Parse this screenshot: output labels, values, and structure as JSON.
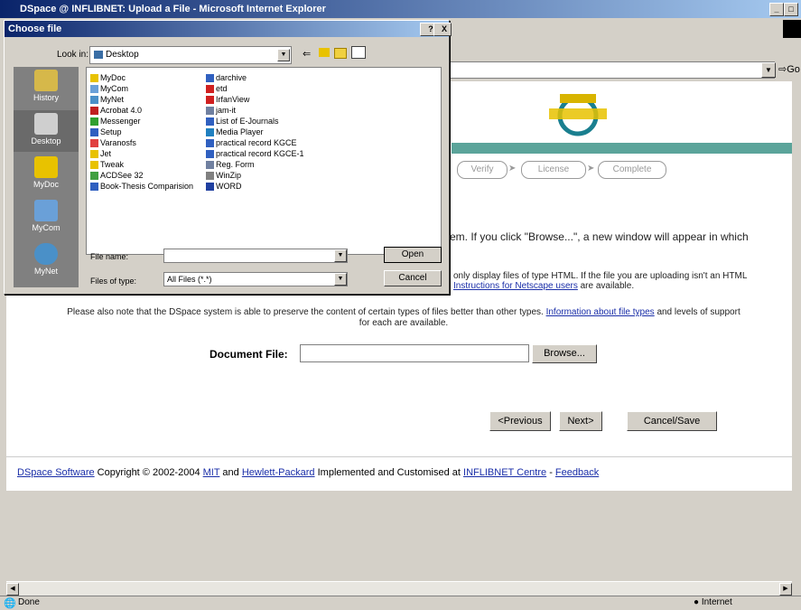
{
  "browser": {
    "title": "DSpace @ INFLIBNET: Upload a File - Microsoft Internet Explorer",
    "go_label": "Go",
    "status": "Done",
    "zone": "Internet"
  },
  "page": {
    "steps": [
      "Verify",
      "License",
      "Complete"
    ],
    "intro_partial": "em. If you click \"Browse...\", a new window will appear in which",
    "note_partial_1": "only display files of type HTML. If the file you are uploading isn't an HTML",
    "note_partial_2_link": "Instructions for Netscape users",
    "note_partial_2_rest": " are available.",
    "preserve_text_1": "Please also note that the DSpace system is able to preserve the content of certain types of files better than other types.",
    "preserve_link": "Information about file types",
    "preserve_text_2": "and levels of support",
    "preserve_text_3": "for each are available.",
    "document_file_label": "Document File:",
    "browse_label": "Browse...",
    "prev_label": "<Previous",
    "next_label": "Next>",
    "cancel_save_label": "Cancel/Save",
    "footer": {
      "dspace_link": "DSpace Software",
      "copyright": " Copyright © 2002-2004 ",
      "mit_link": "MIT",
      "and": " and ",
      "hp_link": "Hewlett-Packard",
      "implemented": " Implemented and Customised at ",
      "inflibnet_link": "INFLIBNET Centre",
      "dash": " - ",
      "feedback_link": "Feedback"
    }
  },
  "dialog": {
    "title": "Choose file",
    "help_btn": "?",
    "close_btn": "X",
    "look_in_label": "Look in:",
    "look_in_value": "Desktop",
    "places": [
      "History",
      "Desktop",
      "MyDoc",
      "MyCom",
      "MyNet"
    ],
    "files_col1": [
      "MyDoc",
      "MyCom",
      "MyNet",
      "Acrobat 4.0",
      "Messenger",
      "Setup",
      "Varanosfs",
      "Jet",
      "Tweak",
      "ACDSee 32",
      "Book-Thesis Comparision"
    ],
    "files_col2": [
      "darchive",
      "etd",
      "IrfanView",
      "jam-it",
      "List of E-Journals",
      "Media Player",
      "practical record KGCE",
      "practical record KGCE-1",
      "Reg. Form",
      "WinZip",
      "WORD"
    ],
    "file_name_label": "File name:",
    "file_name_value": "",
    "files_of_type_label": "Files of type:",
    "files_of_type_value": "All Files (*.*)",
    "open_label": "Open",
    "cancel_label": "Cancel"
  }
}
